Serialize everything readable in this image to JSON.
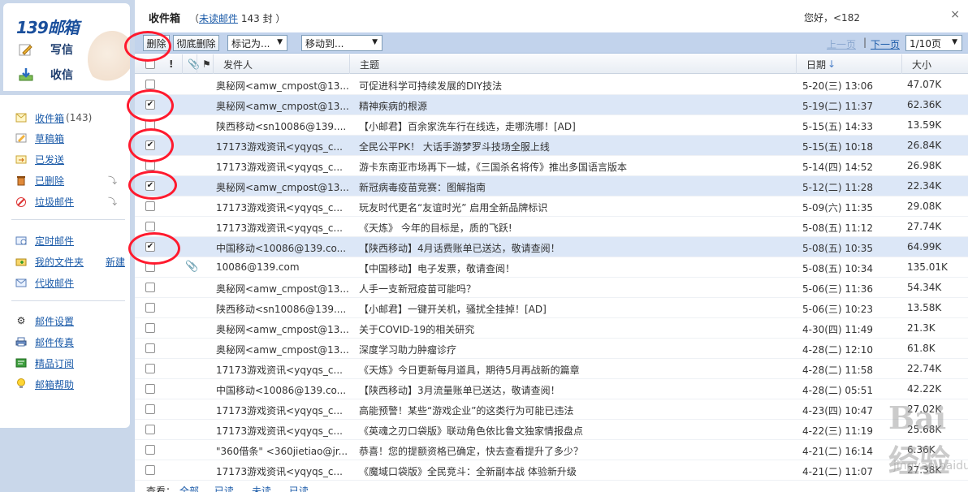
{
  "brand": {
    "logo": "139邮箱"
  },
  "actions": {
    "write": "写信",
    "receive": "收信"
  },
  "folders": [
    {
      "label": "收件箱",
      "count": "(143)"
    },
    {
      "label": "草稿箱"
    },
    {
      "label": "已发送"
    },
    {
      "label": "已删除"
    },
    {
      "label": "垃圾邮件"
    }
  ],
  "tools": [
    {
      "label": "定时邮件"
    },
    {
      "label": "我的文件夹",
      "extra": "新建"
    },
    {
      "label": "代收邮件"
    }
  ],
  "settings": [
    {
      "label": "邮件设置"
    },
    {
      "label": "邮件传真"
    },
    {
      "label": "精品订阅"
    },
    {
      "label": "邮箱帮助"
    }
  ],
  "header": {
    "title": "收件箱",
    "unread_prefix": "（",
    "unread_link": "未读邮件",
    "unread_count": " 143 封 ）",
    "greeting": "您好，<182",
    "close": "×"
  },
  "toolbar": {
    "delete": "删除",
    "purge": "彻底删除",
    "mark_as": "标记为...",
    "move_to": "移动到...",
    "prev": "上一页",
    "sep": "|",
    "next": "下一页",
    "page": "1/10页"
  },
  "columns": {
    "sender": "发件人",
    "subject": "主题",
    "date": "日期",
    "size": "大小",
    "flag": "!"
  },
  "emails": [
    {
      "checked": false,
      "attachment": false,
      "sender": "奥秘网<amw_cmpost@13...",
      "subject": "可促进科学可持续发展的DIY技法",
      "date": "5-20(三) 13:06",
      "size": "47.07K"
    },
    {
      "checked": true,
      "attachment": false,
      "sender": "奥秘网<amw_cmpost@13...",
      "subject": "精神疾病的根源",
      "date": "5-19(二) 11:37",
      "size": "62.36K"
    },
    {
      "checked": false,
      "attachment": false,
      "sender": "陕西移动<sn10086@139....",
      "subject": "【小邮君】百余家洗车行在线选，走哪洗哪！[AD]",
      "date": "5-15(五) 14:33",
      "size": "13.59K"
    },
    {
      "checked": true,
      "attachment": false,
      "sender": "17173游戏资讯<yqyqs_c...",
      "subject": "全民公平PK！ 大话手游梦罗斗技场全服上线",
      "date": "5-15(五) 10:18",
      "size": "26.84K"
    },
    {
      "checked": false,
      "attachment": false,
      "sender": "17173游戏资讯<yqyqs_c...",
      "subject": "游卡东南亚市场再下一城，《三国杀名将传》推出多国语言版本",
      "date": "5-14(四) 14:52",
      "size": "26.98K"
    },
    {
      "checked": true,
      "attachment": false,
      "sender": "奥秘网<amw_cmpost@13...",
      "subject": "新冠病毒疫苗竞赛：图解指南",
      "date": "5-12(二) 11:28",
      "size": "22.34K"
    },
    {
      "checked": false,
      "attachment": false,
      "sender": "17173游戏资讯<yqyqs_c...",
      "subject": "玩友时代更名“友谊时光” 启用全新品牌标识",
      "date": "5-09(六) 11:35",
      "size": "29.08K"
    },
    {
      "checked": false,
      "attachment": false,
      "sender": "17173游戏资讯<yqyqs_c...",
      "subject": "《天炼》 今年的目标是，质的飞跃!",
      "date": "5-08(五) 11:12",
      "size": "27.74K"
    },
    {
      "checked": true,
      "attachment": false,
      "sender": "中国移动<10086@139.co...",
      "subject": "【陕西移动】4月话费账单已送达，敬请查阅！",
      "date": "5-08(五) 10:35",
      "size": "64.99K"
    },
    {
      "checked": false,
      "attachment": true,
      "sender": "10086@139.com",
      "subject": "【中国移动】电子发票，敬请查阅！",
      "date": "5-08(五) 10:34",
      "size": "135.01K"
    },
    {
      "checked": false,
      "attachment": false,
      "sender": "奥秘网<amw_cmpost@13...",
      "subject": "人手一支新冠疫苗可能吗？",
      "date": "5-06(三) 11:36",
      "size": "54.34K"
    },
    {
      "checked": false,
      "attachment": false,
      "sender": "陕西移动<sn10086@139....",
      "subject": "【小邮君】一键开关机，骚扰全挂掉！[AD]",
      "date": "5-06(三) 10:23",
      "size": "13.58K"
    },
    {
      "checked": false,
      "attachment": false,
      "sender": "奥秘网<amw_cmpost@13...",
      "subject": "关于COVID-19的相关研究",
      "date": "4-30(四) 11:49",
      "size": "21.3K"
    },
    {
      "checked": false,
      "attachment": false,
      "sender": "奥秘网<amw_cmpost@13...",
      "subject": "深度学习助力肿瘤诊疗",
      "date": "4-28(二) 12:10",
      "size": "61.8K"
    },
    {
      "checked": false,
      "attachment": false,
      "sender": "17173游戏资讯<yqyqs_c...",
      "subject": "《天炼》今日更新每月道具，期待5月再战新的篇章",
      "date": "4-28(二) 11:58",
      "size": "22.74K"
    },
    {
      "checked": false,
      "attachment": false,
      "sender": "中国移动<10086@139.co...",
      "subject": "【陕西移动】3月流量账单已送达，敬请查阅！",
      "date": "4-28(二) 05:51",
      "size": "42.22K"
    },
    {
      "checked": false,
      "attachment": false,
      "sender": "17173游戏资讯<yqyqs_c...",
      "subject": "高能预警！某些“游戏企业”的这类行为可能已违法",
      "date": "4-23(四) 10:47",
      "size": "27.02K"
    },
    {
      "checked": false,
      "attachment": false,
      "sender": "17173游戏资讯<yqyqs_c...",
      "subject": "《英魂之刃口袋版》联动角色依比鲁文独家情报盘点",
      "date": "4-22(三) 11:19",
      "size": "25.68K"
    },
    {
      "checked": false,
      "attachment": false,
      "sender": "\"360借条\" <360jietiao@jr...",
      "subject": "恭喜！您的提额资格已确定，快去查看提升了多少？",
      "date": "4-21(二) 16:14",
      "size": "6.36K"
    },
    {
      "checked": false,
      "attachment": false,
      "sender": "17173游戏资讯<yqyqs_c...",
      "subject": "《魔域口袋版》全民竞斗：全新副本战 体验新升级",
      "date": "4-21(二) 11:07",
      "size": "27.38K"
    }
  ],
  "footer": {
    "label": "查看：",
    "all": "全部",
    "read": "已读",
    "unread": "未读",
    "flagged": "已读"
  },
  "watermark": {
    "text": "Bai 经验",
    "sub": "jingyan.baidu.com"
  }
}
